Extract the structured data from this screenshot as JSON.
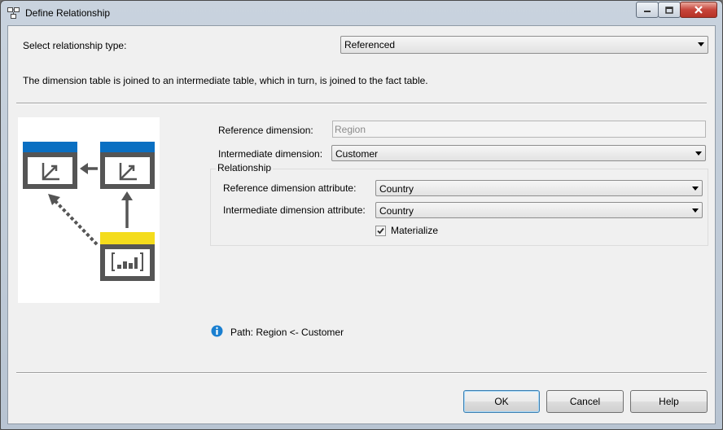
{
  "window": {
    "title": "Define Relationship",
    "controls": [
      "minimize-icon",
      "maximize-icon",
      "close-icon"
    ]
  },
  "header": {
    "type_label": "Select relationship type:",
    "type_value": "Referenced",
    "description": "The dimension table is joined to an intermediate table, which in turn, is joined to the fact table."
  },
  "form": {
    "reference_dimension_label": "Reference dimension:",
    "reference_dimension_value": "Region",
    "intermediate_dimension_label": "Intermediate dimension:",
    "intermediate_dimension_value": "Customer",
    "relationship_group_label": "Relationship",
    "ref_attr_label": "Reference dimension attribute:",
    "ref_attr_value": "Country",
    "int_attr_label": "Intermediate dimension attribute:",
    "int_attr_value": "Country",
    "materialize_label": "Materialize",
    "materialize_checked": true
  },
  "info": {
    "icon": "info-icon",
    "path_text": "Path: Region <- Customer"
  },
  "buttons": {
    "ok": "OK",
    "cancel": "Cancel",
    "help": "Help"
  },
  "colors": {
    "dimension_header": "#0a6fc2",
    "fact_header": "#f4dc1c",
    "diagram_gray": "#555555",
    "info_blue": "#1a7fd0"
  }
}
